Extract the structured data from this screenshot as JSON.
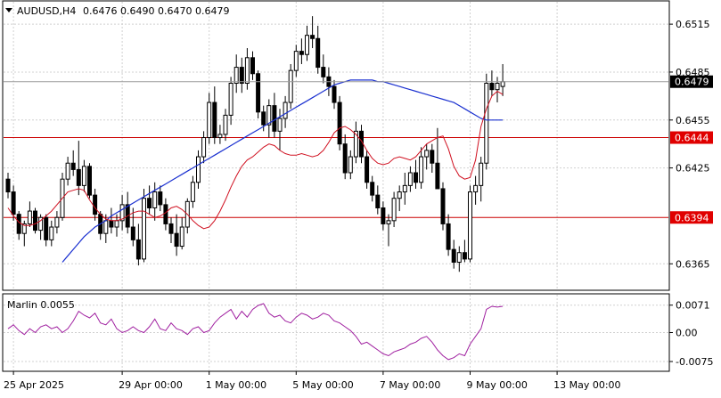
{
  "header": {
    "symbol": "AUDUSD,H4",
    "ohlc": "0.6476 0.6490 0.6470 0.6479"
  },
  "colors": {
    "background": "#ffffff",
    "grid": "#d0d0d0",
    "frame": "#000000",
    "bull_body": "#ffffff",
    "bear_body": "#000000",
    "candle_outline": "#000000",
    "ma_fast": "#d01020",
    "ma_slow": "#1a30d0",
    "level_line": "#cc0000",
    "level_label_bg": "#e00000",
    "current_price_bg": "#000000",
    "marlin_line": "#a020a0"
  },
  "chart_data": [
    {
      "type": "candlestick",
      "title": "AUDUSD,H4",
      "current_price": 0.6479,
      "y_ticks": [
        "0.6515",
        "0.6485",
        "0.6455",
        "0.6425",
        "0.6365"
      ],
      "ylim": [
        0.6349,
        0.6529
      ],
      "x_ticks": [
        {
          "label": "25 Apr 2025",
          "index": 1
        },
        {
          "label": "29 Apr 00:00",
          "index": 21
        },
        {
          "label": "1 May 00:00",
          "index": 37
        },
        {
          "label": "5 May 00:00",
          "index": 53
        },
        {
          "label": "7 May 00:00",
          "index": 69
        },
        {
          "label": "9 May 00:00",
          "index": 85
        },
        {
          "label": "13 May 00:00",
          "index": 101
        }
      ],
      "horizontal_levels": [
        {
          "value": 0.6444,
          "label": "0.6444"
        },
        {
          "value": 0.6394,
          "label": "0.6394"
        }
      ],
      "moving_average_fast": [
        0.64,
        0.6395,
        0.6391,
        0.6389,
        0.6389,
        0.639,
        0.6392,
        0.6395,
        0.6398,
        0.6402,
        0.6406,
        0.641,
        0.6411,
        0.6412,
        0.6411,
        0.6405,
        0.64,
        0.6396,
        0.6393,
        0.6392,
        0.6392,
        0.6393,
        0.6395,
        0.6397,
        0.6398,
        0.6398,
        0.6396,
        0.6394,
        0.6395,
        0.6397,
        0.64,
        0.6401,
        0.6399,
        0.6396,
        0.6392,
        0.6389,
        0.6387,
        0.6388,
        0.6392,
        0.6398,
        0.6405,
        0.6413,
        0.642,
        0.6426,
        0.643,
        0.6432,
        0.6435,
        0.6438,
        0.644,
        0.6439,
        0.6436,
        0.6434,
        0.6433,
        0.6433,
        0.6434,
        0.6433,
        0.6432,
        0.6433,
        0.6436,
        0.6441,
        0.6447,
        0.645,
        0.6451,
        0.6449,
        0.6446,
        0.6442,
        0.6436,
        0.6431,
        0.6428,
        0.6427,
        0.6428,
        0.6431,
        0.6432,
        0.6431,
        0.643,
        0.6432,
        0.6436,
        0.644,
        0.6442,
        0.6444,
        0.6445,
        0.6437,
        0.6426,
        0.642,
        0.6418,
        0.6419,
        0.643,
        0.6451,
        0.6462,
        0.647,
        0.6473,
        0.6471
      ],
      "moving_average_slow": [
        0.6366,
        0.637,
        0.6374,
        0.6378,
        0.6382,
        0.6385,
        0.6388,
        0.639,
        0.6392,
        0.6395,
        0.6397,
        0.6399,
        0.6401,
        0.6403,
        0.6405,
        0.6407,
        0.6409,
        0.6411,
        0.6413,
        0.6415,
        0.6417,
        0.6419,
        0.6421,
        0.6423,
        0.6425,
        0.6427,
        0.6429,
        0.6431,
        0.6433,
        0.6435,
        0.6437,
        0.6439,
        0.6441,
        0.6443,
        0.6445,
        0.6447,
        0.6449,
        0.6451,
        0.6453,
        0.6455,
        0.6457,
        0.6459,
        0.6461,
        0.6463,
        0.6465,
        0.6467,
        0.6469,
        0.6471,
        0.6473,
        0.6475,
        0.6477,
        0.6478,
        0.6479,
        0.648,
        0.648,
        0.648,
        0.648,
        0.648,
        0.6479,
        0.6479,
        0.6478,
        0.6477,
        0.6476,
        0.6475,
        0.6474,
        0.6473,
        0.6472,
        0.6471,
        0.647,
        0.6469,
        0.6468,
        0.6467,
        0.6466,
        0.6464,
        0.6462,
        0.646,
        0.6458,
        0.6456,
        0.6455,
        0.6455,
        0.6455,
        0.6455
      ],
      "candles": [
        [
          0.6418,
          0.6422,
          0.6406,
          0.641
        ],
        [
          0.641,
          0.6414,
          0.6392,
          0.6396
        ],
        [
          0.6396,
          0.6398,
          0.638,
          0.6384
        ],
        [
          0.6384,
          0.6392,
          0.6376,
          0.639
        ],
        [
          0.639,
          0.6404,
          0.6388,
          0.6398
        ],
        [
          0.6398,
          0.64,
          0.6384,
          0.6386
        ],
        [
          0.6386,
          0.6396,
          0.638,
          0.6394
        ],
        [
          0.6394,
          0.6396,
          0.6376,
          0.638
        ],
        [
          0.638,
          0.6392,
          0.6376,
          0.6388
        ],
        [
          0.6388,
          0.6398,
          0.6384,
          0.6394
        ],
        [
          0.6394,
          0.6422,
          0.6392,
          0.6418
        ],
        [
          0.6418,
          0.6432,
          0.6414,
          0.6428
        ],
        [
          0.6428,
          0.6436,
          0.642,
          0.6424
        ],
        [
          0.6424,
          0.6442,
          0.6408,
          0.6414
        ],
        [
          0.6414,
          0.643,
          0.641,
          0.6426
        ],
        [
          0.6426,
          0.6428,
          0.6406,
          0.6408
        ],
        [
          0.6408,
          0.6412,
          0.6392,
          0.6396
        ],
        [
          0.6396,
          0.6398,
          0.638,
          0.6384
        ],
        [
          0.6384,
          0.6396,
          0.6378,
          0.6392
        ],
        [
          0.6392,
          0.64,
          0.6384,
          0.6388
        ],
        [
          0.6388,
          0.6396,
          0.6382,
          0.6392
        ],
        [
          0.6392,
          0.6408,
          0.6386,
          0.6402
        ],
        [
          0.6402,
          0.641,
          0.6384,
          0.6388
        ],
        [
          0.6388,
          0.64,
          0.6376,
          0.638
        ],
        [
          0.638,
          0.639,
          0.6364,
          0.6368
        ],
        [
          0.6368,
          0.6412,
          0.6366,
          0.6406
        ],
        [
          0.6406,
          0.6414,
          0.6396,
          0.64
        ],
        [
          0.64,
          0.6416,
          0.6392,
          0.641
        ],
        [
          0.641,
          0.6414,
          0.6398,
          0.6402
        ],
        [
          0.6402,
          0.6406,
          0.6386,
          0.639
        ],
        [
          0.639,
          0.6394,
          0.6378,
          0.6384
        ],
        [
          0.6384,
          0.6396,
          0.637,
          0.6376
        ],
        [
          0.6376,
          0.6394,
          0.6374,
          0.6388
        ],
        [
          0.6388,
          0.6406,
          0.6384,
          0.6404
        ],
        [
          0.6404,
          0.642,
          0.64,
          0.6416
        ],
        [
          0.6416,
          0.6436,
          0.6412,
          0.6432
        ],
        [
          0.6432,
          0.6448,
          0.6428,
          0.6444
        ],
        [
          0.6444,
          0.6472,
          0.644,
          0.6466
        ],
        [
          0.6466,
          0.6476,
          0.644,
          0.6444
        ],
        [
          0.6444,
          0.6452,
          0.644,
          0.6446
        ],
        [
          0.6446,
          0.6462,
          0.6442,
          0.6458
        ],
        [
          0.6458,
          0.6482,
          0.6452,
          0.6478
        ],
        [
          0.6478,
          0.6496,
          0.6472,
          0.6488
        ],
        [
          0.6488,
          0.6494,
          0.6472,
          0.6478
        ],
        [
          0.6478,
          0.65,
          0.6474,
          0.6494
        ],
        [
          0.6494,
          0.6498,
          0.648,
          0.6484
        ],
        [
          0.6484,
          0.6486,
          0.6456,
          0.646
        ],
        [
          0.646,
          0.6464,
          0.6448,
          0.6452
        ],
        [
          0.6452,
          0.6468,
          0.6444,
          0.6464
        ],
        [
          0.6464,
          0.6472,
          0.6444,
          0.6448
        ],
        [
          0.6448,
          0.6462,
          0.6436,
          0.6456
        ],
        [
          0.6456,
          0.647,
          0.645,
          0.6466
        ],
        [
          0.6466,
          0.649,
          0.6462,
          0.6486
        ],
        [
          0.6486,
          0.6502,
          0.6482,
          0.6498
        ],
        [
          0.6498,
          0.6506,
          0.649,
          0.6496
        ],
        [
          0.6496,
          0.6514,
          0.6492,
          0.6508
        ],
        [
          0.6508,
          0.652,
          0.65,
          0.6506
        ],
        [
          0.6506,
          0.6514,
          0.6484,
          0.6488
        ],
        [
          0.6488,
          0.6496,
          0.6478,
          0.6482
        ],
        [
          0.6482,
          0.6488,
          0.647,
          0.6476
        ],
        [
          0.6476,
          0.648,
          0.6462,
          0.6466
        ],
        [
          0.6466,
          0.647,
          0.6436,
          0.644
        ],
        [
          0.644,
          0.6446,
          0.6418,
          0.6422
        ],
        [
          0.6422,
          0.6436,
          0.6418,
          0.6432
        ],
        [
          0.6432,
          0.6454,
          0.6428,
          0.6448
        ],
        [
          0.6448,
          0.6452,
          0.6428,
          0.6432
        ],
        [
          0.6432,
          0.6436,
          0.6412,
          0.6416
        ],
        [
          0.6416,
          0.642,
          0.6404,
          0.6408
        ],
        [
          0.6408,
          0.6414,
          0.6396,
          0.64
        ],
        [
          0.64,
          0.6404,
          0.6386,
          0.639
        ],
        [
          0.639,
          0.6396,
          0.6376,
          0.6392
        ],
        [
          0.6392,
          0.641,
          0.6388,
          0.6406
        ],
        [
          0.6406,
          0.6414,
          0.6398,
          0.641
        ],
        [
          0.641,
          0.6422,
          0.6402,
          0.6414
        ],
        [
          0.6414,
          0.6426,
          0.641,
          0.6422
        ],
        [
          0.6422,
          0.643,
          0.6412,
          0.6416
        ],
        [
          0.6416,
          0.6438,
          0.6412,
          0.6432
        ],
        [
          0.6432,
          0.644,
          0.6424,
          0.6436
        ],
        [
          0.6436,
          0.644,
          0.6422,
          0.6428
        ],
        [
          0.6428,
          0.645,
          0.642,
          0.6412
        ],
        [
          0.6412,
          0.6416,
          0.6386,
          0.639
        ],
        [
          0.639,
          0.6396,
          0.637,
          0.6374
        ],
        [
          0.6374,
          0.638,
          0.6362,
          0.6366
        ],
        [
          0.6366,
          0.6376,
          0.636,
          0.6372
        ],
        [
          0.6372,
          0.638,
          0.6366,
          0.6368
        ],
        [
          0.6368,
          0.6414,
          0.6366,
          0.641
        ],
        [
          0.641,
          0.642,
          0.6402,
          0.6414
        ],
        [
          0.6414,
          0.6432,
          0.6404,
          0.6428
        ],
        [
          0.6428,
          0.6484,
          0.6424,
          0.6478
        ],
        [
          0.6478,
          0.6486,
          0.647,
          0.6474
        ],
        [
          0.6474,
          0.6482,
          0.6466,
          0.6478
        ],
        [
          0.6476,
          0.649,
          0.647,
          0.6479
        ]
      ]
    },
    {
      "type": "line",
      "title": "Marlin 0.0055",
      "y_ticks": [
        "0.0071",
        "0.00",
        "-0.0075"
      ],
      "ylim": [
        -0.0098,
        0.0098
      ],
      "series": [
        {
          "values": [
            0.001,
            0.002,
            0.0005,
            -0.0005,
            0.001,
            0.0,
            0.0015,
            0.002,
            0.001,
            0.0015,
            0.0,
            0.001,
            0.003,
            0.0055,
            0.0045,
            0.0038,
            0.005,
            0.0025,
            0.002,
            0.0035,
            0.001,
            0.0,
            0.0005,
            0.0015,
            0.0005,
            0.0,
            0.0015,
            0.0035,
            0.001,
            0.0005,
            0.0025,
            0.001,
            0.0005,
            -0.0005,
            0.001,
            0.0015,
            0.0,
            0.0005,
            0.0025,
            0.004,
            0.005,
            0.006,
            0.0035,
            0.0055,
            0.004,
            0.006,
            0.007,
            0.0075,
            0.005,
            0.004,
            0.0045,
            0.003,
            0.0025,
            0.004,
            0.005,
            0.0045,
            0.0035,
            0.004,
            0.005,
            0.0045,
            0.003,
            0.0025,
            0.0015,
            0.0005,
            -0.001,
            -0.003,
            -0.0025,
            -0.0035,
            -0.0045,
            -0.0055,
            -0.006,
            -0.005,
            -0.0045,
            -0.004,
            -0.003,
            -0.0025,
            -0.0015,
            -0.001,
            -0.0025,
            -0.0045,
            -0.006,
            -0.007,
            -0.0065,
            -0.0055,
            -0.006,
            -0.003,
            -0.001,
            0.001,
            0.006,
            0.0068,
            0.0066,
            0.0068
          ]
        }
      ]
    }
  ]
}
